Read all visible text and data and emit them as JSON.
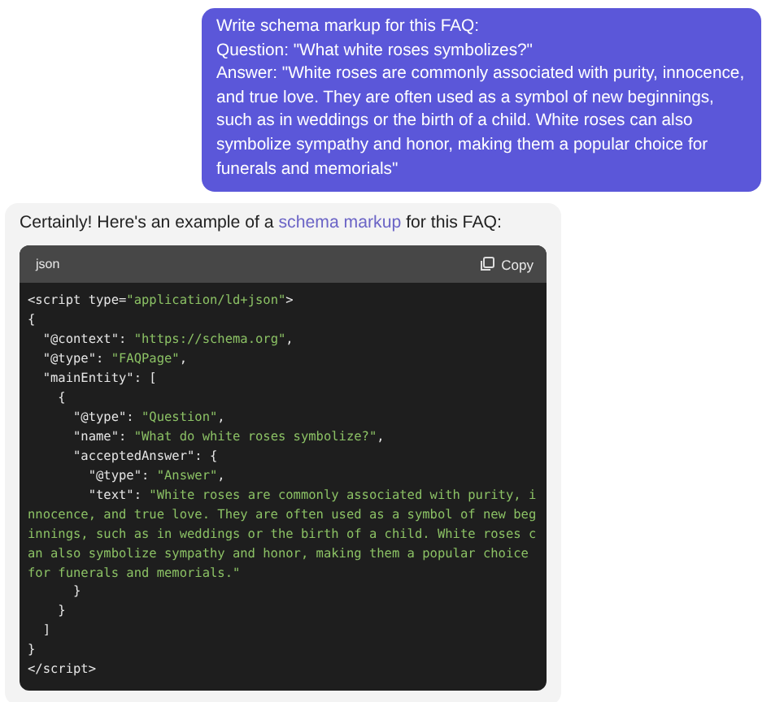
{
  "user_message": {
    "lines": [
      "Write schema markup for this FAQ:",
      "Question: \"What white roses symbolizes?\"",
      "Answer: \"White roses are commonly associated with purity, innocence, and true love. They are often used as a symbol of new beginnings, such as in weddings or the birth of a child. White roses can also symbolize sympathy and honor, making them a popular choice for funerals and memorials\""
    ]
  },
  "assistant_message": {
    "intro": {
      "before": "Certainly! Here's an example of a ",
      "link": "schema markup",
      "after": " for this FAQ:"
    },
    "code_block": {
      "language": "json",
      "copy_label": "Copy",
      "lines": [
        [
          {
            "kind": "plain",
            "text": "<script type="
          },
          {
            "kind": "string",
            "text": "\"application/ld+json\""
          },
          {
            "kind": "plain",
            "text": ">"
          }
        ],
        [
          {
            "kind": "plain",
            "text": "{"
          }
        ],
        [
          {
            "kind": "plain",
            "text": "  \"@context\": "
          },
          {
            "kind": "string",
            "text": "\"https://schema.org\""
          },
          {
            "kind": "plain",
            "text": ","
          }
        ],
        [
          {
            "kind": "plain",
            "text": "  \"@type\": "
          },
          {
            "kind": "string",
            "text": "\"FAQPage\""
          },
          {
            "kind": "plain",
            "text": ","
          }
        ],
        [
          {
            "kind": "plain",
            "text": "  \"mainEntity\": ["
          }
        ],
        [
          {
            "kind": "plain",
            "text": "    {"
          }
        ],
        [
          {
            "kind": "plain",
            "text": "      \"@type\": "
          },
          {
            "kind": "string",
            "text": "\"Question\""
          },
          {
            "kind": "plain",
            "text": ","
          }
        ],
        [
          {
            "kind": "plain",
            "text": "      \"name\": "
          },
          {
            "kind": "string",
            "text": "\"What do white roses symbolize?\""
          },
          {
            "kind": "plain",
            "text": ","
          }
        ],
        [
          {
            "kind": "plain",
            "text": "      \"acceptedAnswer\": {"
          }
        ],
        [
          {
            "kind": "plain",
            "text": "        \"@type\": "
          },
          {
            "kind": "string",
            "text": "\"Answer\""
          },
          {
            "kind": "plain",
            "text": ","
          }
        ],
        [
          {
            "kind": "plain",
            "text": "        \"text\": "
          },
          {
            "kind": "string",
            "text": "\"White roses are commonly associated with purity, i"
          }
        ],
        [
          {
            "kind": "string",
            "text": "nnocence, and true love. They are often used as a symbol of new beg"
          }
        ],
        [
          {
            "kind": "string",
            "text": "innings, such as in weddings or the birth of a child. White roses c"
          }
        ],
        [
          {
            "kind": "string",
            "text": "an also symbolize sympathy and honor, making them a popular choice"
          }
        ],
        [
          {
            "kind": "string",
            "text": "for funerals and memorials.\""
          }
        ],
        [
          {
            "kind": "plain",
            "text": "      }"
          }
        ],
        [
          {
            "kind": "plain",
            "text": "    }"
          }
        ],
        [
          {
            "kind": "plain",
            "text": "  ]"
          }
        ],
        [
          {
            "kind": "plain",
            "text": "}"
          }
        ],
        [
          {
            "kind": "plain",
            "text": "</script>"
          }
        ]
      ]
    }
  }
}
